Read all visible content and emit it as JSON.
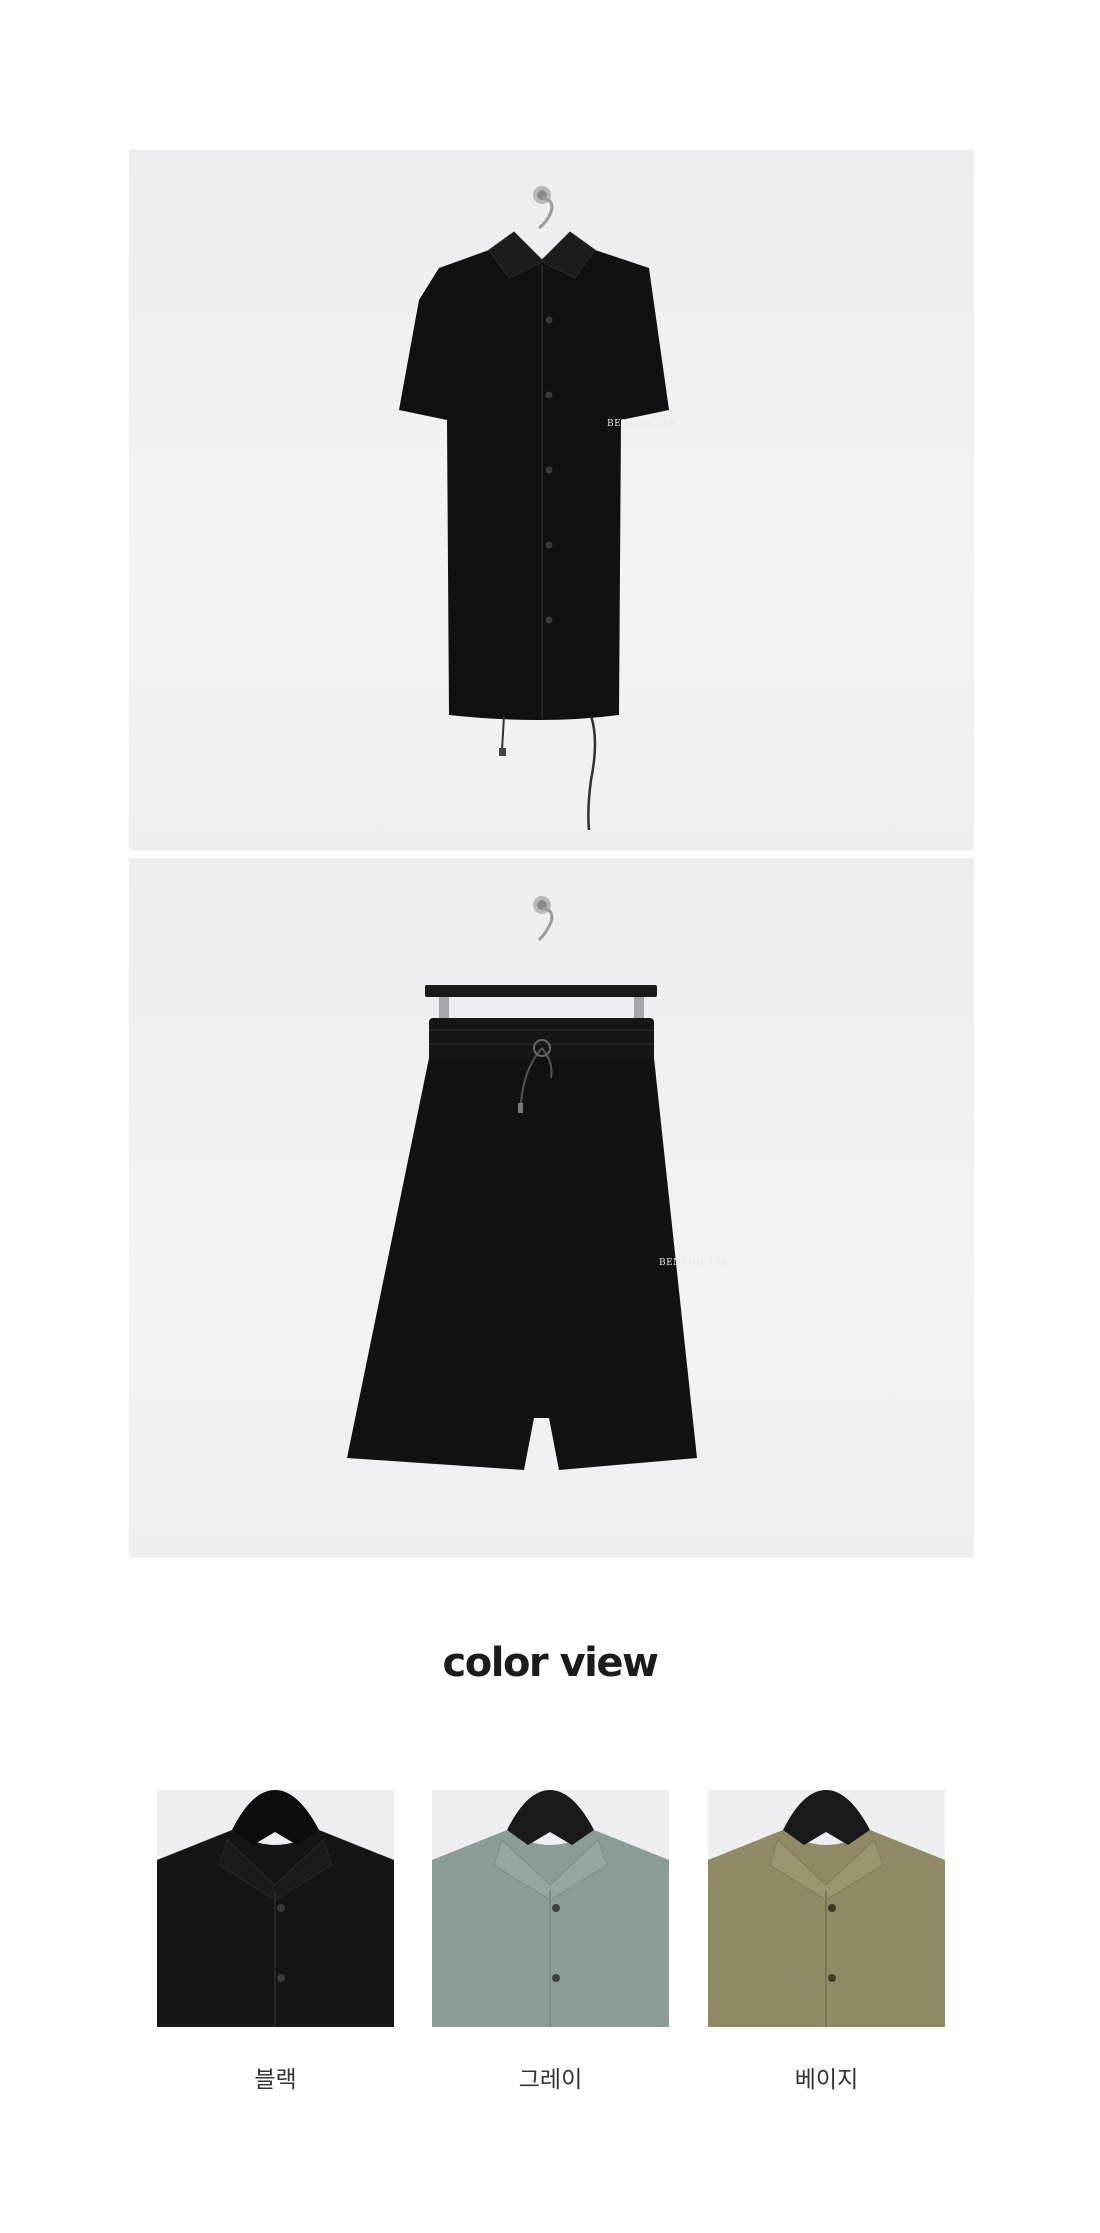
{
  "products": {
    "shirt": {
      "icon": "short-sleeve-shirt-icon",
      "logo_text": "BENEDICTES"
    },
    "shorts": {
      "icon": "shorts-icon",
      "logo_text": "BENEDICTES"
    }
  },
  "color_view": {
    "title": "color view",
    "swatches": [
      {
        "label": "블랙",
        "color": "#151515"
      },
      {
        "label": "그레이",
        "color": "#8b9c97"
      },
      {
        "label": "베이지",
        "color": "#8f8a66"
      }
    ]
  }
}
